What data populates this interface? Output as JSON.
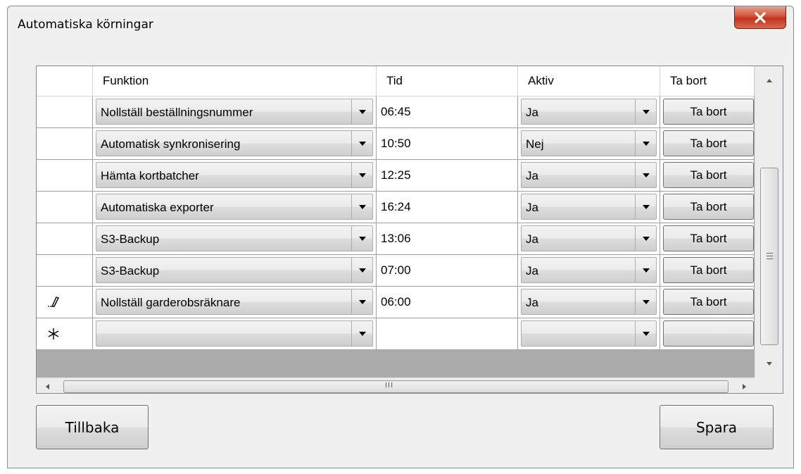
{
  "window": {
    "title": "Automatiska körningar"
  },
  "columns": [
    "Funktion",
    "Tid",
    "Aktiv",
    "Ta bort"
  ],
  "rows": [
    {
      "marker": "",
      "funktion": "Nollställ beställningsnummer",
      "tid": "06:45",
      "aktiv": "Ja",
      "button": "Ta bort"
    },
    {
      "marker": "",
      "funktion": "Automatisk synkronisering",
      "tid": "10:50",
      "aktiv": "Nej",
      "button": "Ta bort"
    },
    {
      "marker": "",
      "funktion": "Hämta kortbatcher",
      "tid": "12:25",
      "aktiv": "Ja",
      "button": "Ta bort"
    },
    {
      "marker": "",
      "funktion": "Automatiska exporter",
      "tid": "16:24",
      "aktiv": "Ja",
      "button": "Ta bort"
    },
    {
      "marker": "",
      "funktion": "S3-Backup",
      "tid": "13:06",
      "aktiv": "Ja",
      "button": "Ta bort"
    },
    {
      "marker": "",
      "funktion": "S3-Backup",
      "tid": "07:00",
      "aktiv": "Ja",
      "button": "Ta bort"
    },
    {
      "marker": "pencil-icon",
      "funktion": "Nollställ garderobsräknare",
      "tid": "06:00",
      "aktiv": "Ja",
      "button": "Ta bort"
    },
    {
      "marker": "asterisk-icon",
      "funktion": "",
      "tid": "",
      "aktiv": "",
      "button": ""
    }
  ],
  "hscroll_label": "III",
  "buttons": {
    "back": "Tillbaka",
    "save": "Spara"
  },
  "colors": {
    "close": "#c2321c",
    "grid_background": "#ababab"
  }
}
